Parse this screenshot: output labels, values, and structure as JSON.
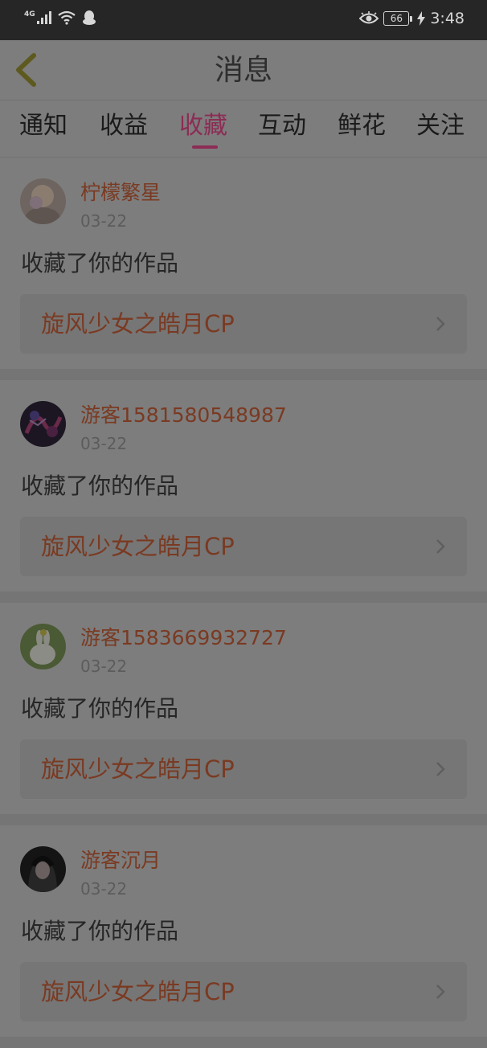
{
  "status_bar": {
    "network": "4G",
    "battery": "66",
    "time": "3:48"
  },
  "header": {
    "title": "消息"
  },
  "tabs": [
    {
      "label": "通知",
      "active": false
    },
    {
      "label": "收益",
      "active": false
    },
    {
      "label": "收藏",
      "active": true
    },
    {
      "label": "互动",
      "active": false
    },
    {
      "label": "鲜花",
      "active": false
    },
    {
      "label": "关注",
      "active": false
    }
  ],
  "feed": [
    {
      "user": "柠檬繁星",
      "date": "03-22",
      "action": "收藏了你的作品",
      "work": "旋风少女之皓月CP"
    },
    {
      "user": "游客1581580548987",
      "date": "03-22",
      "action": "收藏了你的作品",
      "work": "旋风少女之皓月CP"
    },
    {
      "user": "游客1583669932727",
      "date": "03-22",
      "action": "收藏了你的作品",
      "work": "旋风少女之皓月CP"
    },
    {
      "user": "游客沉月",
      "date": "03-22",
      "action": "收藏了你的作品",
      "work": "旋风少女之皓月CP"
    }
  ],
  "colors": {
    "accent": "#8c2c54",
    "username": "#7a3a22",
    "overlay_bg": "#7d7d7d"
  }
}
